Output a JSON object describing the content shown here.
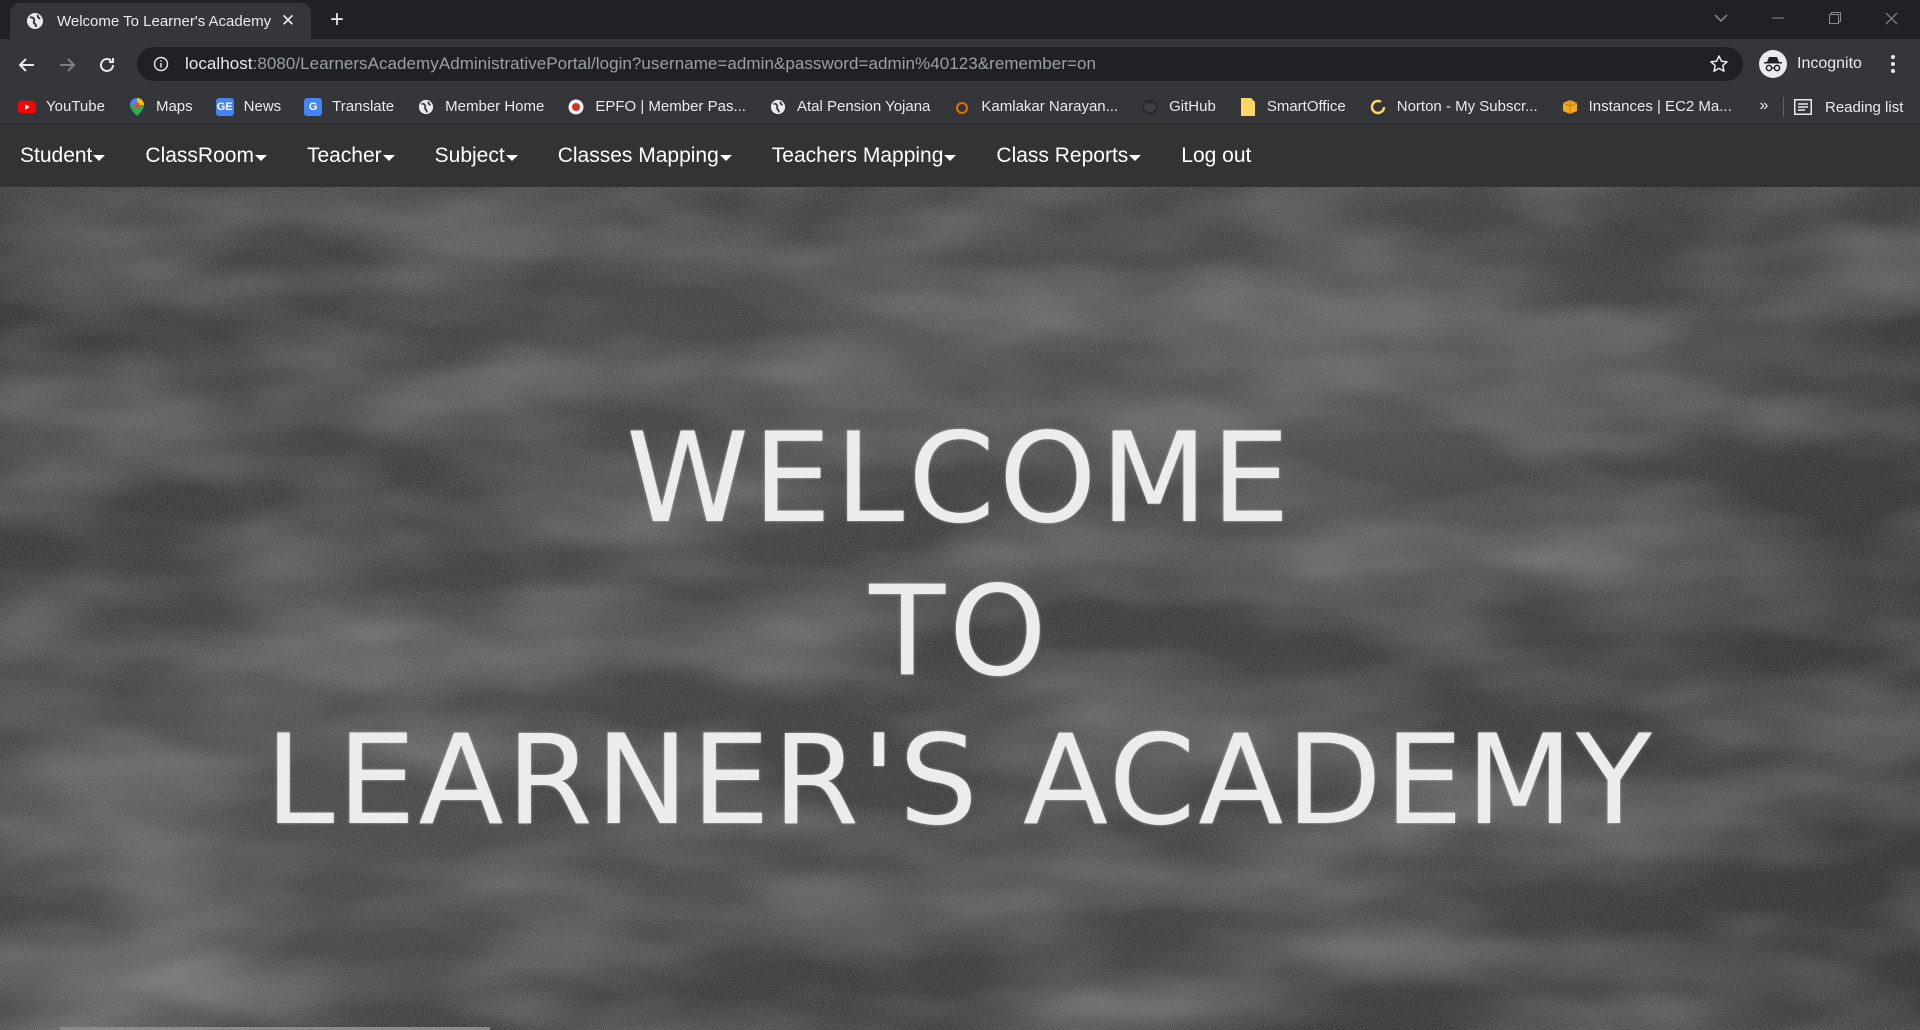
{
  "browser": {
    "tab": {
      "title": "Welcome To Learner's Academy"
    },
    "url": {
      "host": "localhost",
      "rest": ":8080/LearnersAcademyAdministrativePortal/login?username=admin&password=admin%40123&remember=on"
    },
    "profile_label": "Incognito",
    "bookmarks": [
      {
        "label": "YouTube",
        "icon": "youtube-icon"
      },
      {
        "label": "Maps",
        "icon": "maps-icon"
      },
      {
        "label": "News",
        "icon": "news-icon"
      },
      {
        "label": "Translate",
        "icon": "translate-icon"
      },
      {
        "label": "Member Home",
        "icon": "globe-icon"
      },
      {
        "label": "EPFO | Member Pas...",
        "icon": "epfo-icon"
      },
      {
        "label": "Atal Pension Yojana",
        "icon": "globe-icon"
      },
      {
        "label": "Kamlakar Narayan...",
        "icon": "k-icon"
      },
      {
        "label": "GitHub",
        "icon": "github-icon"
      },
      {
        "label": "SmartOffice",
        "icon": "note-icon"
      },
      {
        "label": "Norton - My Subscr...",
        "icon": "norton-icon"
      },
      {
        "label": "Instances | EC2 Ma...",
        "icon": "aws-icon"
      }
    ],
    "overflow": "»",
    "reading_list": "Reading list"
  },
  "navbar": {
    "items": [
      {
        "label": "Student",
        "dropdown": true
      },
      {
        "label": "ClassRoom",
        "dropdown": true
      },
      {
        "label": "Teacher",
        "dropdown": true
      },
      {
        "label": "Subject",
        "dropdown": true
      },
      {
        "label": "Classes Mapping",
        "dropdown": true
      },
      {
        "label": "Teachers Mapping",
        "dropdown": true
      },
      {
        "label": "Class Reports",
        "dropdown": true
      },
      {
        "label": "Log out",
        "dropdown": false
      }
    ]
  },
  "hero": {
    "line1": "WELCOME",
    "line2": "TO",
    "line3": "LEARNER'S ACADEMY"
  },
  "colors": {
    "navbar_bg": "#333333",
    "chrome_dark": "#202124",
    "chrome_toolbar": "#35363a",
    "chalk_text": "#ececec"
  }
}
